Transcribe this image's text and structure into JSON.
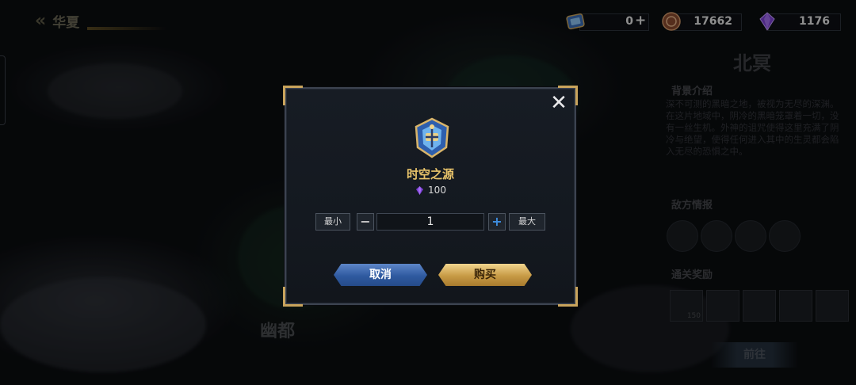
{
  "header": {
    "back_title": "华夏"
  },
  "currencies": {
    "ticket": {
      "icon": "ticket-icon",
      "value": "0"
    },
    "coin": {
      "icon": "bronze-coin-icon",
      "value": "17662"
    },
    "gem": {
      "icon": "purple-gem-icon",
      "value": "1176"
    }
  },
  "map": {
    "region_bottom": "幽都"
  },
  "right_panel": {
    "title": "北冥",
    "background_heading": "背景介绍",
    "background_text": "深不可测的黑暗之地，被视为无尽的深渊。在这片地域中，阴冷的黑暗笼罩着一切，没有一丝生机。外神的诅咒使得这里充满了阴冷与绝望，使得任何进入其中的生灵都会陷入无尽的恐惧之中。",
    "enemy_heading": "敌方情报",
    "reward_heading": "通关奖励",
    "reward_count": "150",
    "goto_label": "前往"
  },
  "modal": {
    "item_name": "时空之源",
    "price": "100",
    "quantity": "1",
    "min_label": "最小",
    "max_label": "最大",
    "cancel_label": "取消",
    "buy_label": "购买"
  },
  "colors": {
    "gold_accent": "#c9a45c",
    "item_name": "#e8c36a",
    "cancel_blue": "#2f5aa0",
    "buy_gold": "#c79a45"
  }
}
